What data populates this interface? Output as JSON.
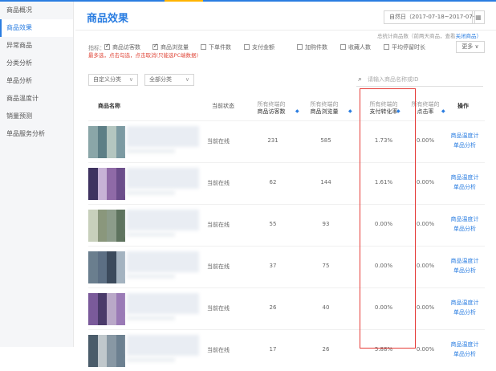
{
  "sidebar": {
    "items": [
      {
        "label": "商品概况"
      },
      {
        "label": "商品效果"
      },
      {
        "label": "异常商品"
      },
      {
        "label": "分类分析"
      },
      {
        "label": "单品分析"
      },
      {
        "label": "商品温度计"
      },
      {
        "label": "销量预测"
      },
      {
        "label": "单品服务分析"
      }
    ],
    "active_index": 1
  },
  "header": {
    "title": "商品效果",
    "date_range": "自然日（2017-07-18~2017-07-18）",
    "calendar_icon": "calendar-icon"
  },
  "notice": {
    "text": "总统计商品数（前两天商品，查看",
    "link": "关闭商品）"
  },
  "metrics": {
    "label": "指标：",
    "items": [
      {
        "label": "商品访客数",
        "checked": true
      },
      {
        "label": "商品浏览量",
        "checked": true
      },
      {
        "label": "下单件数",
        "checked": false
      },
      {
        "label": "支付金额",
        "checked": false
      },
      {
        "label": "加购件数",
        "checked": false
      },
      {
        "label": "收藏人数",
        "checked": false
      },
      {
        "label": "平均停留时长",
        "checked": false
      }
    ],
    "hint": "最多选，点击勾选，点击取消(只能选PC端数据)",
    "more_label": "更多"
  },
  "filters": {
    "category": "自定义分类",
    "group": "全部分类",
    "search_placeholder": "请输入商品名称或ID"
  },
  "table": {
    "headers": {
      "name": "商品名称",
      "status": "当前状态",
      "visitors_top": "所有终端的",
      "visitors": "商品访客数",
      "views_top": "所有终端的",
      "views": "商品浏览量",
      "conv_top": "所有终端的",
      "conv": "支付转化率",
      "click_top": "所有终端的",
      "click": "点击率",
      "ops": "操作"
    },
    "rows": [
      {
        "status": "当前在线",
        "visitors": "231",
        "views": "585",
        "conv": "1.73%",
        "click": "0.00%",
        "op1": "商品温度计",
        "op2": "单品分析"
      },
      {
        "status": "当前在线",
        "visitors": "62",
        "views": "144",
        "conv": "1.61%",
        "click": "0.00%",
        "op1": "商品温度计",
        "op2": "单品分析"
      },
      {
        "status": "当前在线",
        "visitors": "55",
        "views": "93",
        "conv": "0.00%",
        "click": "0.00%",
        "op1": "商品温度计",
        "op2": "单品分析"
      },
      {
        "status": "当前在线",
        "visitors": "37",
        "views": "75",
        "conv": "0.00%",
        "click": "0.00%",
        "op1": "商品温度计",
        "op2": "单品分析"
      },
      {
        "status": "当前在线",
        "visitors": "26",
        "views": "40",
        "conv": "0.00%",
        "click": "0.00%",
        "op1": "商品温度计",
        "op2": "单品分析"
      },
      {
        "status": "当前在线",
        "visitors": "17",
        "views": "26",
        "conv": "5.88%",
        "click": "0.00%",
        "op1": "商品温度计",
        "op2": "单品分析"
      }
    ]
  },
  "colors": {
    "accent": "#2a7de1",
    "highlight": "#e53935"
  }
}
